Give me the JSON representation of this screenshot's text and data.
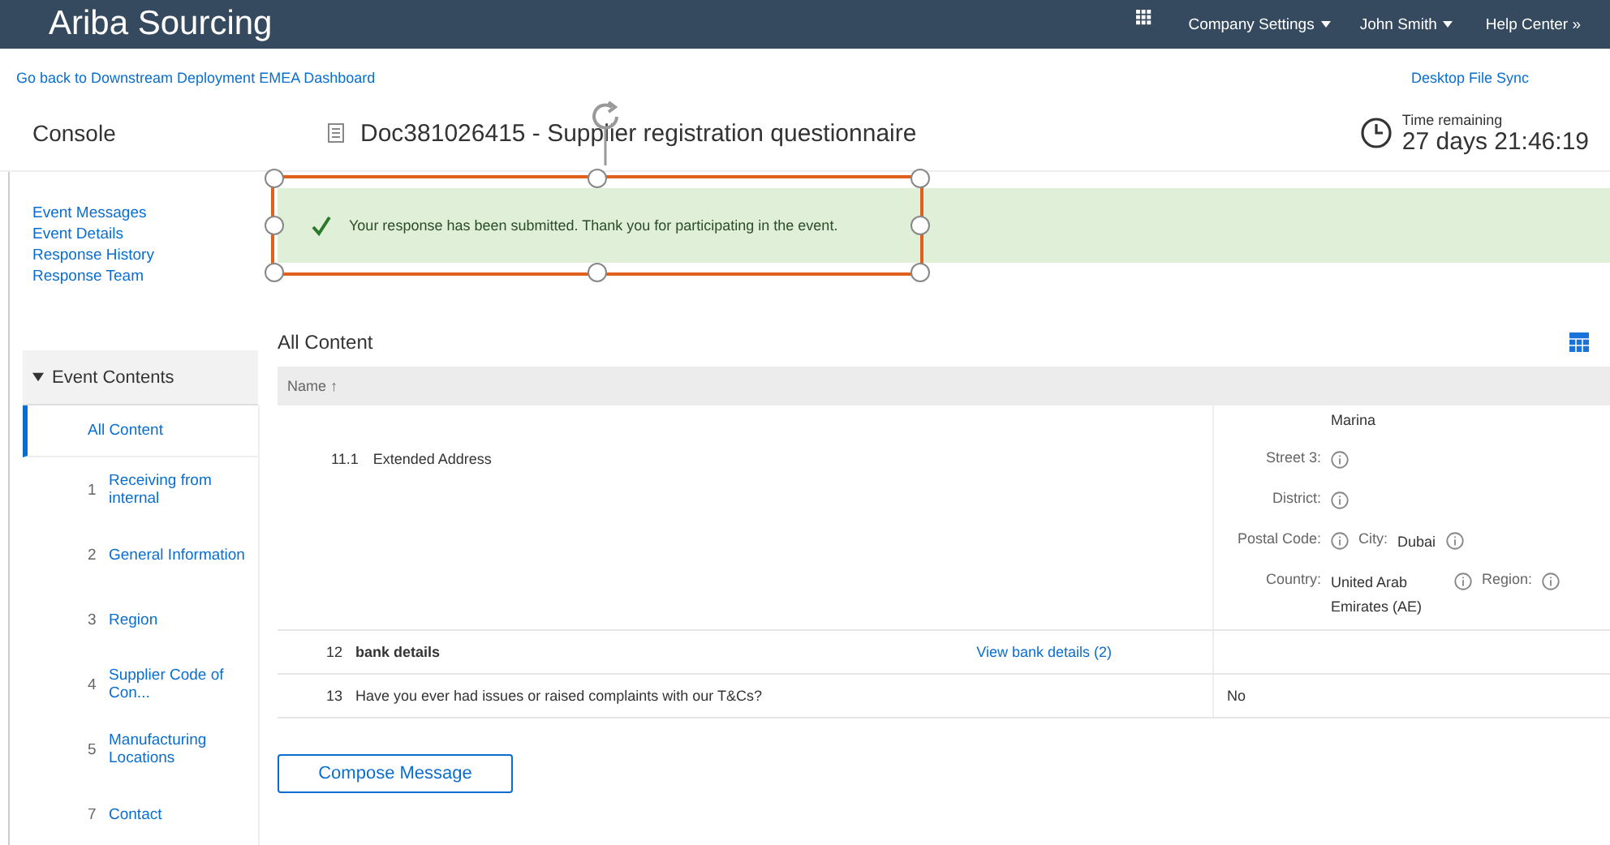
{
  "header": {
    "brand": "Ariba Sourcing",
    "menus": [
      {
        "label": "Company Settings",
        "dropdown": true
      },
      {
        "label": "John Smith",
        "dropdown": true
      }
    ],
    "help": "Help Center",
    "help_arrow": "»"
  },
  "links": {
    "back": "Go back to Downstream Deployment EMEA Dashboard",
    "sync": "Desktop File Sync"
  },
  "console": "Console",
  "document": {
    "title": "Doc381026415 - Supplier registration questionnaire"
  },
  "timer": {
    "label": "Time remaining",
    "value": "27 days 21:46:19"
  },
  "sidebar": {
    "links": [
      "Event Messages",
      "Event Details",
      "Response History",
      "Response Team"
    ],
    "section": {
      "label": "Event Contents",
      "expanded": true
    },
    "items": [
      {
        "label": "All Content",
        "selected": true
      },
      {
        "number": "1",
        "label": "Receiving from internal",
        "selected": false
      },
      {
        "number": "2",
        "label": "General Information",
        "selected": false
      },
      {
        "number": "3",
        "label": "Region",
        "selected": false
      },
      {
        "number": "4",
        "label": "Supplier Code of Con...",
        "selected": false
      },
      {
        "number": "5",
        "label": "Manufacturing Locations",
        "selected": false
      },
      {
        "number": "7",
        "label": "Contact",
        "selected": false
      }
    ]
  },
  "banner": {
    "message": "Your response has been submitted. Thank you for participating in the event.",
    "selection_frame": true
  },
  "content": {
    "title": "All Content",
    "columns": [
      "Name ↑"
    ],
    "rows": [
      {
        "kind": "address",
        "number": "11.1",
        "label": "Extended Address",
        "lines": [
          [
            {
              "kind": "spacer"
            },
            {
              "kind": "value",
              "text": "Marina"
            }
          ],
          [
            {
              "kind": "label",
              "text": "Street 3:"
            },
            {
              "kind": "info"
            }
          ],
          [
            {
              "kind": "label",
              "text": "District:"
            },
            {
              "kind": "info"
            }
          ],
          [
            {
              "kind": "label",
              "text": "Postal Code:"
            },
            {
              "kind": "info"
            },
            {
              "kind": "label",
              "text": "City:"
            },
            {
              "kind": "value",
              "text": "Dubai"
            },
            {
              "kind": "info"
            }
          ],
          [
            {
              "kind": "label",
              "text": "Country:"
            },
            {
              "kind": "value",
              "text": "United Arab Emirates (AE)"
            },
            {
              "kind": "info"
            },
            {
              "kind": "label",
              "text": "Region:"
            },
            {
              "kind": "info"
            }
          ]
        ]
      },
      {
        "kind": "section",
        "number": "12",
        "label": "bank details",
        "link": "View bank details (2)"
      },
      {
        "kind": "question",
        "number": "13",
        "label": "Have you ever had issues or raised complaints with our T&Cs?",
        "answer": "No"
      }
    ]
  },
  "compose_button": "Compose Message"
}
